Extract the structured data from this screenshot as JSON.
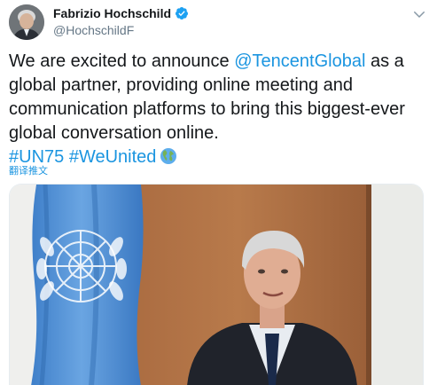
{
  "author": {
    "display_name": "Fabrizio Hochschild",
    "handle": "@HochschildF",
    "verified": true
  },
  "tweet": {
    "text_before": "We are excited to announce ",
    "mention": "@TencentGlobal",
    "text_after": " as a global partner, providing online meeting and communication platforms to bring this biggest-ever global conversation online.",
    "hashtag_1": "#UN75",
    "hashtag_2": "#WeUnited",
    "emoji": "globe-showing-americas"
  },
  "translate_label": "翻译推文",
  "media": {
    "kind": "video",
    "description_icon": "video-thumbnail"
  },
  "colors": {
    "link": "#1b95e0",
    "verified": "#1da1f2",
    "text": "#14171a",
    "secondary": "#657786"
  }
}
